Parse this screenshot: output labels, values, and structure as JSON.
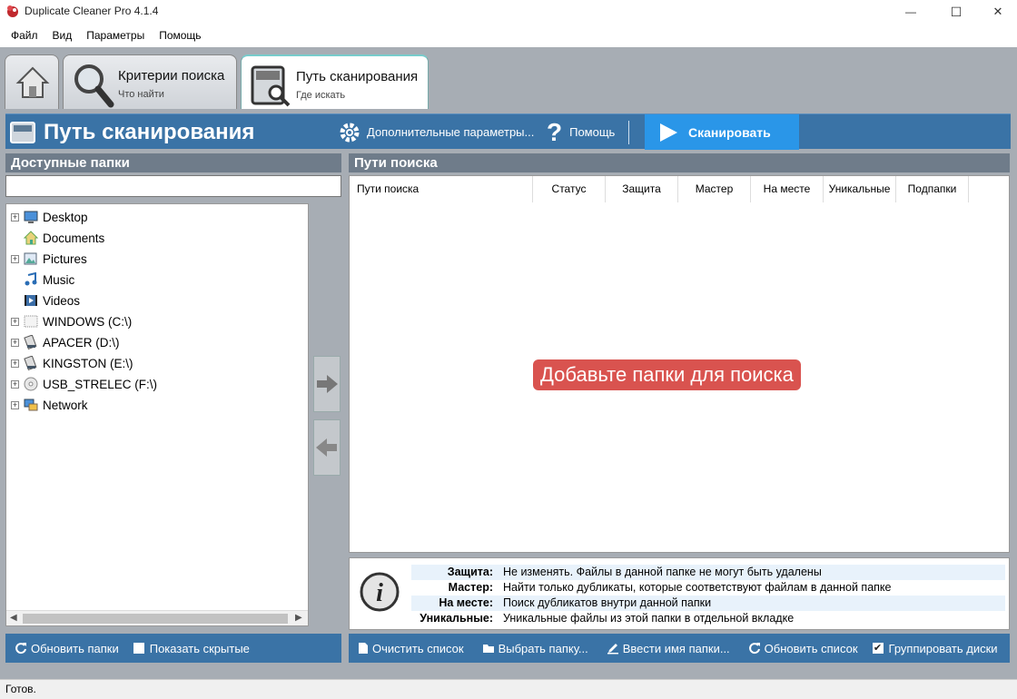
{
  "window": {
    "title": "Duplicate Cleaner Pro 4.1.4",
    "min_glyph": "—",
    "max_glyph": "☐",
    "close_glyph": "✕"
  },
  "menu": [
    "Файл",
    "Вид",
    "Параметры",
    "Помощь"
  ],
  "tabs": {
    "criteria": {
      "title": "Критерии поиска",
      "sub": "Что найти"
    },
    "path": {
      "title": "Путь сканирования",
      "sub": "Где искать"
    }
  },
  "header": {
    "title": "Путь сканирования",
    "advanced_label": "Дополнительные параметры...",
    "help_label": "Помощь",
    "scan_label": "Сканировать"
  },
  "left": {
    "section_title": "Доступные папки",
    "filter_value": "",
    "tree": [
      {
        "label": "Desktop",
        "expandable": true,
        "icon": "desktop-icon"
      },
      {
        "label": "Documents",
        "expandable": false,
        "icon": "documents-icon"
      },
      {
        "label": "Pictures",
        "expandable": true,
        "icon": "pictures-icon"
      },
      {
        "label": "Music",
        "expandable": false,
        "icon": "music-icon"
      },
      {
        "label": "Videos",
        "expandable": false,
        "icon": "videos-icon"
      },
      {
        "label": "WINDOWS (C:\\)",
        "expandable": true,
        "icon": "drive-icon"
      },
      {
        "label": "APACER (D:\\)",
        "expandable": true,
        "icon": "usb-drive-icon"
      },
      {
        "label": "KINGSTON (E:\\)",
        "expandable": true,
        "icon": "usb-drive-icon"
      },
      {
        "label": "USB_STRELEC (F:\\)",
        "expandable": true,
        "icon": "cd-drive-icon"
      },
      {
        "label": "Network",
        "expandable": true,
        "icon": "network-icon"
      }
    ],
    "refresh_label": "Обновить папки",
    "show_hidden_label": "Показать скрытые"
  },
  "right": {
    "section_title": "Пути поиска",
    "columns": [
      "Пути поиска",
      "Статус",
      "Защита",
      "Мастер",
      "На месте",
      "Уникальные",
      "Подпапки"
    ],
    "empty_message": "Добавьте папки для поиска",
    "info": [
      {
        "key": "Защита:",
        "value": "Не изменять. Файлы в данной папке не могут быть удалены"
      },
      {
        "key": "Мастер:",
        "value": "Найти только дубликаты, которые соответствуют файлам в данной папке"
      },
      {
        "key": "На месте:",
        "value": "Поиск дубликатов внутри данной папки"
      },
      {
        "key": "Уникальные:",
        "value": "Уникальные файлы из этой папки в отдельной вкладке"
      }
    ],
    "toolbar": {
      "clear": "Очистить список",
      "choose": "Выбрать папку...",
      "enter": "Ввести имя папки...",
      "refresh": "Обновить список",
      "group_drives": "Группировать диски",
      "group_drives_checked": true
    }
  },
  "status": "Готов."
}
